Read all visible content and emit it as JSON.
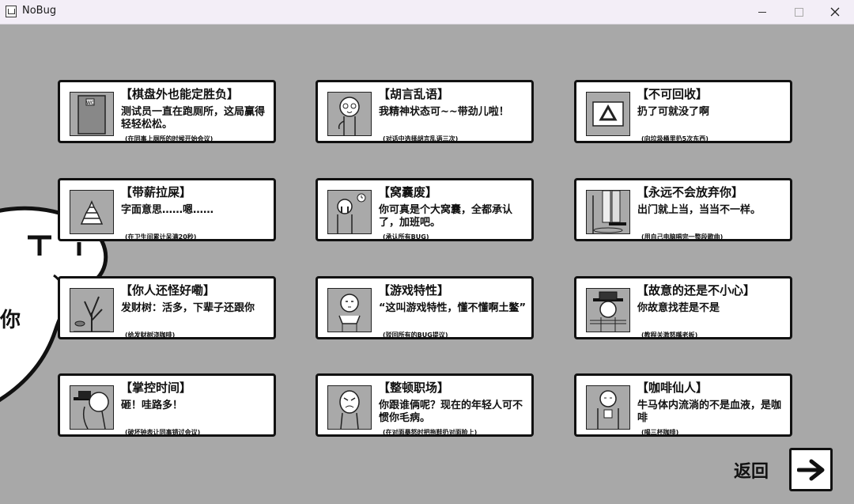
{
  "window": {
    "title": "NoBug"
  },
  "ghost": {
    "text": "你"
  },
  "achievements": [
    {
      "title": "【棋盘外也能定胜负】",
      "desc": "测试员一直在跑厕所，这局赢得轻轻松松。",
      "cond": "(在同事上厕所的时候开始会议)",
      "icon": "door-icon"
    },
    {
      "title": "【胡言乱语】",
      "desc": "我精神状态可~~带劲儿啦！",
      "cond": "(对话中选择胡言乱语三次)",
      "icon": "crazy-face-icon"
    },
    {
      "title": "【不可回收】",
      "desc": "扔了可就没了啊",
      "cond": "(向垃圾桶里扔5次东西)",
      "icon": "recycle-icon"
    },
    {
      "title": "【带薪拉屎】",
      "desc": "字面意思……嗯……",
      "cond": "(在卫生间累计呆满20秒)",
      "icon": "poop-icon"
    },
    {
      "title": "【窝囊废】",
      "desc": "你可真是个大窝囊，全都承认了，加班吧。",
      "cond": "(承认所有BUG)",
      "icon": "crying-clock-icon"
    },
    {
      "title": "【永远不会放弃你】",
      "desc": "出门就上当，当当不一样。",
      "cond": "(用自己电脑唱完一整段歌曲)",
      "icon": "legs-icon"
    },
    {
      "title": "【你人还怪好嘞】",
      "desc": "发财树：活多，下辈子还跟你",
      "cond": "(给发财树浇咖啡)",
      "icon": "plant-icon"
    },
    {
      "title": "【游戏特性】",
      "desc": "“这叫游戏特性，懂不懂啊土鳖”",
      "cond": "(驳回所有的BUG提议)",
      "icon": "shrug-icon"
    },
    {
      "title": "【故意的还是不小心】",
      "desc": "你故意找茬是不是",
      "cond": "(教程关激怒嘴老板)",
      "icon": "hat-man-icon"
    },
    {
      "title": "【掌控时间】",
      "desc": "砸！哇路多！",
      "cond": "(破坏钟表让同事错过会议)",
      "icon": "time-stop-icon"
    },
    {
      "title": "【整顿职场】",
      "desc": "你跟谁俩呢？现在的年轻人可不惯你毛病。",
      "cond": "(在对面暴怒时把拖鞋扔对面脸上)",
      "icon": "angry-face-icon"
    },
    {
      "title": "【咖啡仙人】",
      "desc": "牛马体内流淌的不是血液，是咖啡",
      "cond": "(喝三杯咖啡)",
      "icon": "coffee-man-icon"
    }
  ],
  "back": {
    "label": "返回",
    "icon": "arrow-right-icon"
  }
}
